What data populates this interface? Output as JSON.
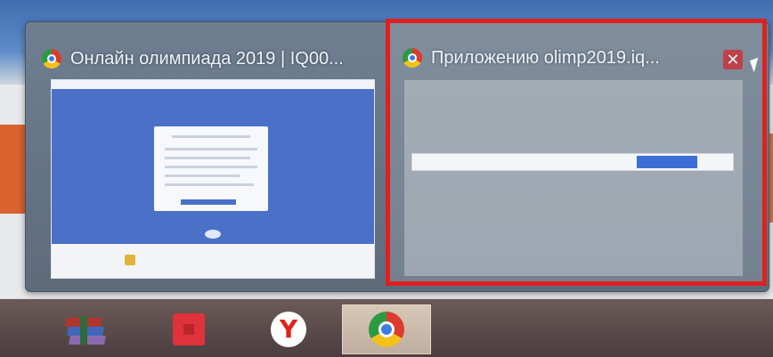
{
  "thumbnails": [
    {
      "title": "Онлайн олимпиада 2019 | IQ00...",
      "icon": "chrome-icon",
      "selected": false
    },
    {
      "title": "Приложению olimp2019.iq...",
      "icon": "chrome-icon",
      "selected": true,
      "close_label": "✕"
    }
  ],
  "taskbar": {
    "items": [
      {
        "name": "winrar",
        "icon": "winrar-icon",
        "active": false
      },
      {
        "name": "red-app",
        "icon": "red-square-icon",
        "active": false
      },
      {
        "name": "yandex-browser",
        "icon": "yandex-icon",
        "glyph": "Y",
        "active": false
      },
      {
        "name": "google-chrome",
        "icon": "chrome-icon",
        "active": true
      }
    ]
  },
  "colors": {
    "selection_border": "#e02020",
    "popup_background": "#6f7f91",
    "taskbar_background": "#5a4a4a",
    "preview_blue": "#4a70c8"
  }
}
